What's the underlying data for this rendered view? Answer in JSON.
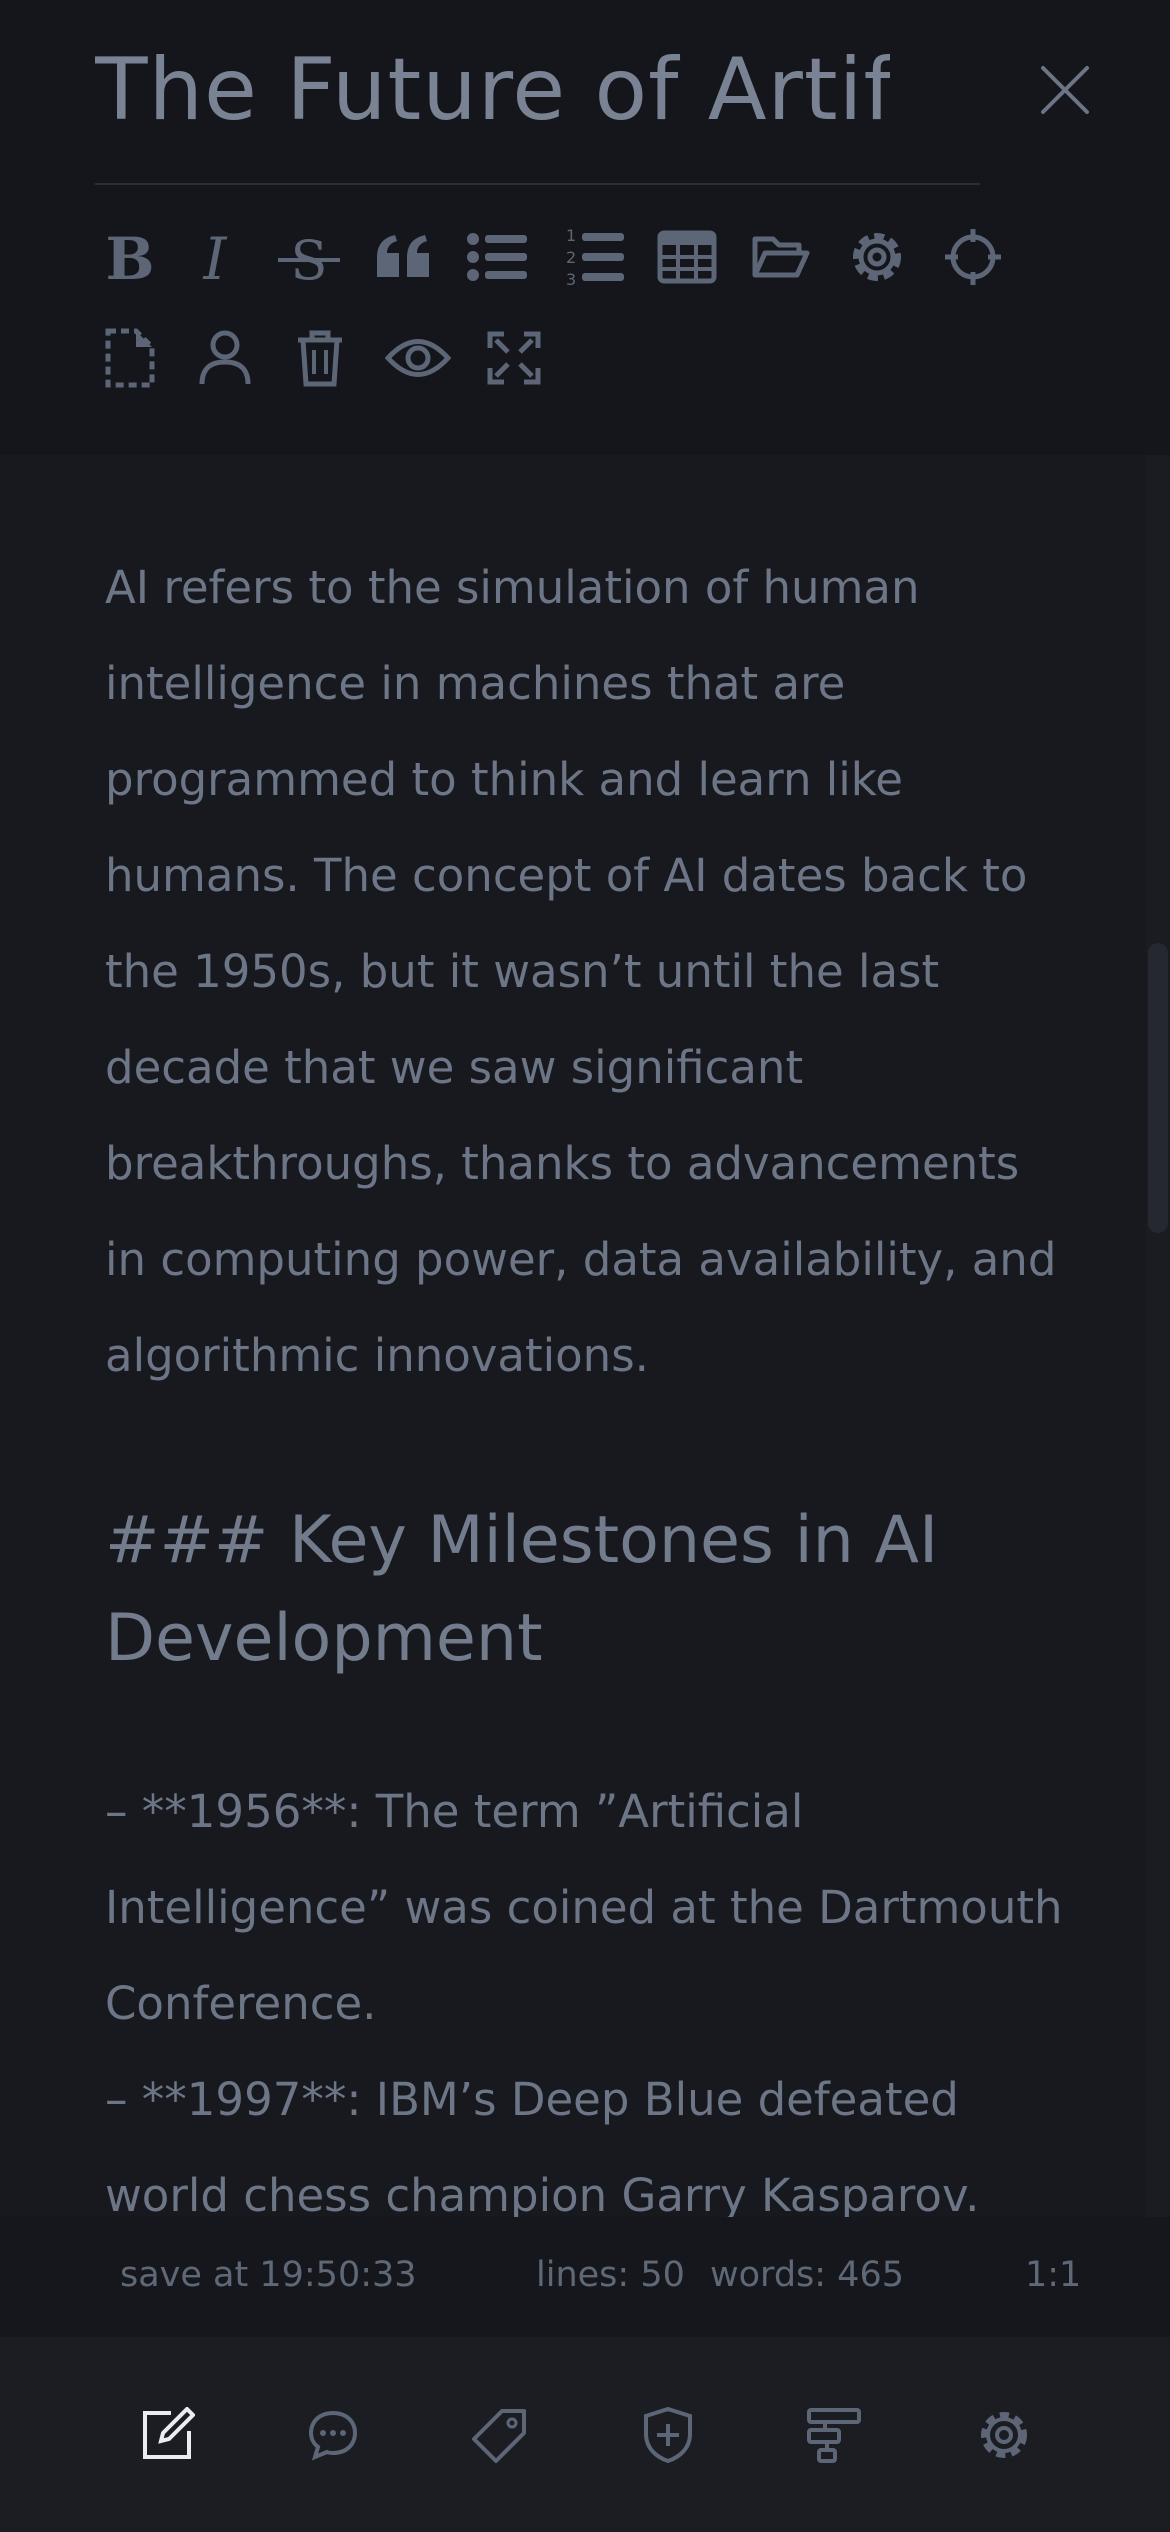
{
  "header": {
    "title": "The Future of Artific",
    "close_icon": "close-icon",
    "toolbar": [
      "bold-icon",
      "italic-icon",
      "strikethrough-icon",
      "quote-icon",
      "bullet-list-icon",
      "numbered-list-icon",
      "table-icon",
      "folder-open-icon",
      "gear-icon",
      "crosshair-icon",
      "new-file-icon",
      "user-icon",
      "trash-icon",
      "eye-icon",
      "fullscreen-icon"
    ]
  },
  "editor": {
    "paragraph": "AI refers to the simulation of human intelligence in machines that are programmed to think and learn like humans. The concept of AI dates back to the 1950s, but it wasn’t until the last decade that we saw significant breakthroughs, thanks to advancements in computing power, data availability, and algorithmic innovations.",
    "heading": "### Key Milestones in AI Development",
    "list_text": "– **1956**: The term ”Artificial Intelligence” was coined at the Dartmouth Conference.\n– **1997**: IBM’s Deep Blue defeated world chess champion Garry Kasparov."
  },
  "status": {
    "saved": "save at 19:50:33",
    "lines": "lines: 50",
    "words": "words: 465",
    "position": "1:1"
  },
  "bottom_nav": [
    "edit-icon",
    "chat-icon",
    "tag-icon",
    "shield-plus-icon",
    "structure-icon",
    "settings-icon"
  ],
  "colors": {
    "background": "#17191f",
    "header_bg": "#14161c",
    "text": "#6d7686",
    "active_icon": "#e9ecf1"
  }
}
